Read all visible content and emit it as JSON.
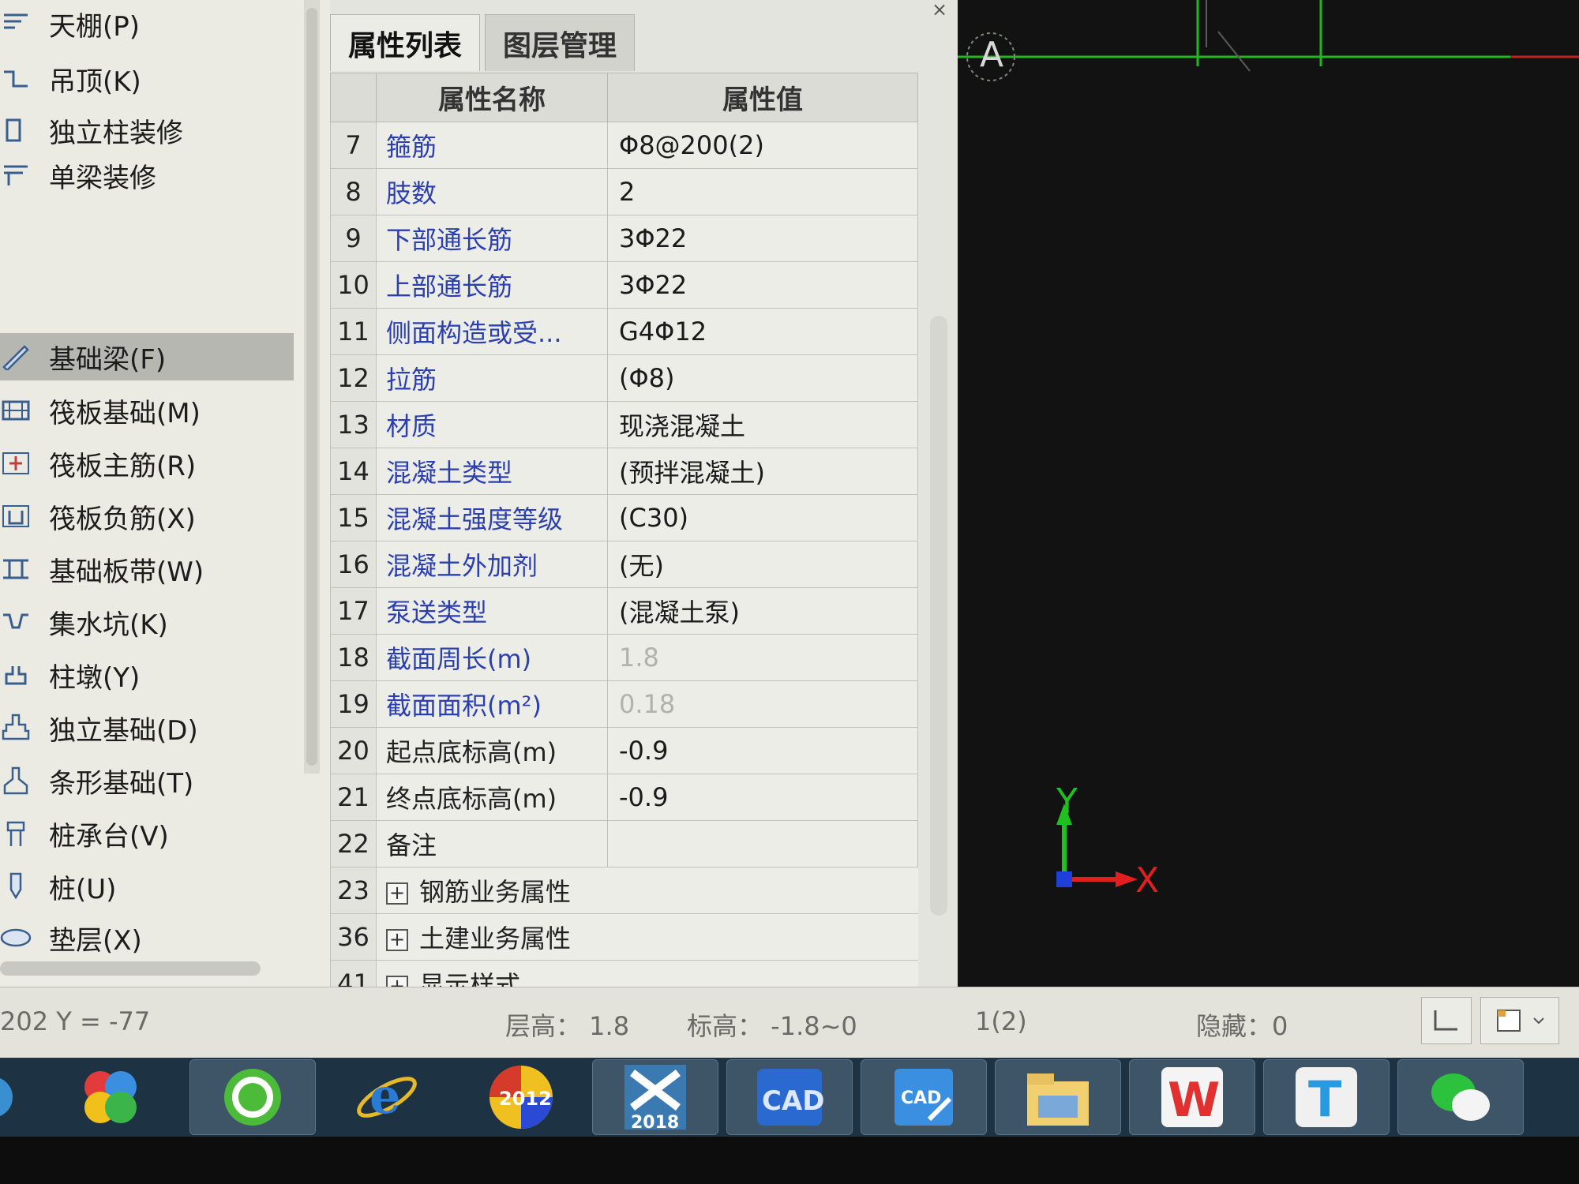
{
  "left_panel": {
    "items": [
      {
        "label": "天棚(P)",
        "icon": "ceiling-icon"
      },
      {
        "label": "吊顶(K)",
        "icon": "suspended-ceiling-icon"
      },
      {
        "label": "独立柱装修",
        "icon": "column-decoration-icon"
      },
      {
        "label": "单梁装修",
        "icon": "beam-decoration-icon"
      },
      {
        "label": "基础梁(F)",
        "icon": "foundation-beam-icon",
        "selected": true
      },
      {
        "label": "筏板基础(M)",
        "icon": "raft-foundation-icon"
      },
      {
        "label": "筏板主筋(R)",
        "icon": "raft-main-rebar-icon"
      },
      {
        "label": "筏板负筋(X)",
        "icon": "raft-negative-rebar-icon"
      },
      {
        "label": "基础板带(W)",
        "icon": "foundation-strip-icon"
      },
      {
        "label": "集水坑(K)",
        "icon": "sump-pit-icon"
      },
      {
        "label": "柱墩(Y)",
        "icon": "column-pier-icon"
      },
      {
        "label": "独立基础(D)",
        "icon": "isolated-footing-icon"
      },
      {
        "label": "条形基础(T)",
        "icon": "strip-footing-icon"
      },
      {
        "label": "桩承台(V)",
        "icon": "pile-cap-icon"
      },
      {
        "label": "桩(U)",
        "icon": "pile-icon"
      },
      {
        "label": "垫层(X)",
        "icon": "cushion-layer-icon"
      }
    ]
  },
  "property_panel": {
    "tabs": [
      "属性列表",
      "图层管理"
    ],
    "close": "×",
    "headers": {
      "name": "属性名称",
      "value": "属性值"
    },
    "rows": [
      {
        "idx": "7",
        "name": "箍筋",
        "value": "Φ8@200(2)"
      },
      {
        "idx": "8",
        "name": "肢数",
        "value": "2"
      },
      {
        "idx": "9",
        "name": "下部通长筋",
        "value": "3Φ22"
      },
      {
        "idx": "10",
        "name": "上部通长筋",
        "value": "3Φ22"
      },
      {
        "idx": "11",
        "name": "侧面构造或受...",
        "value": "G4Φ12"
      },
      {
        "idx": "12",
        "name": "拉筋",
        "value": "(Φ8)"
      },
      {
        "idx": "13",
        "name": "材质",
        "value": "现浇混凝土"
      },
      {
        "idx": "14",
        "name": "混凝土类型",
        "value": "(预拌混凝土)"
      },
      {
        "idx": "15",
        "name": "混凝土强度等级",
        "value": "(C30)"
      },
      {
        "idx": "16",
        "name": "混凝土外加剂",
        "value": "(无)"
      },
      {
        "idx": "17",
        "name": "泵送类型",
        "value": "(混凝土泵)"
      },
      {
        "idx": "18",
        "name": "截面周长(m)",
        "value": "1.8",
        "muted": true
      },
      {
        "idx": "19",
        "name": "截面面积(m²)",
        "value": "0.18",
        "muted": true
      },
      {
        "idx": "20",
        "name": "起点底标高(m)",
        "value": "-0.9",
        "plain": true
      },
      {
        "idx": "21",
        "name": "终点底标高(m)",
        "value": "-0.9",
        "plain": true
      },
      {
        "idx": "22",
        "name": "备注",
        "value": "",
        "plain": true
      },
      {
        "idx": "23",
        "name": "钢筋业务属性",
        "group": true
      },
      {
        "idx": "36",
        "name": "土建业务属性",
        "group": true
      },
      {
        "idx": "41",
        "name": "显示样式",
        "group": true
      }
    ]
  },
  "canvas": {
    "axis_label": "A",
    "x_label": "X",
    "y_label": "Y",
    "colors": {
      "background": "#121212",
      "axis_line": "#1fb81f",
      "x_axis": "#e02020",
      "y_axis": "#20c020",
      "origin": "#1e3fd8"
    }
  },
  "status_bar": {
    "coords": "202 Y = -77",
    "floor_height": "层高：  1.8",
    "elevation": "标高：  -1.8~0",
    "floor": "1(2)",
    "hidden": "隐藏：0"
  },
  "taskbar": {
    "apps": [
      {
        "name": "start-icon"
      },
      {
        "name": "pinwheel-app-icon"
      },
      {
        "name": "360-browser-icon"
      },
      {
        "name": "internet-explorer-icon"
      },
      {
        "name": "glodon-2012-icon",
        "label": "2012"
      },
      {
        "name": "glodon-2018-icon",
        "label": "2018"
      },
      {
        "name": "cad-app-icon",
        "label": "CAD"
      },
      {
        "name": "cad-viewer-icon",
        "label": "CAD"
      },
      {
        "name": "file-explorer-icon"
      },
      {
        "name": "wps-icon",
        "label": "W"
      },
      {
        "name": "text-app-icon",
        "label": "T"
      },
      {
        "name": "wechat-icon"
      }
    ]
  }
}
